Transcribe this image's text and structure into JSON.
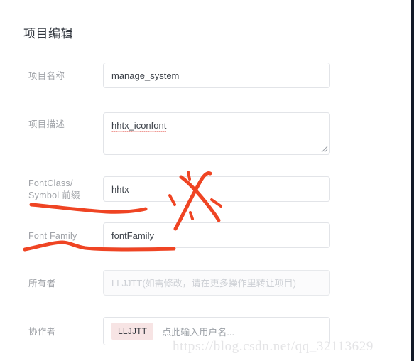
{
  "page": {
    "title": "项目编辑"
  },
  "form": {
    "rows": [
      {
        "label": "项目名称",
        "type": "text",
        "value": "manage_system",
        "name": "project-name"
      },
      {
        "label": "项目描述",
        "type": "textarea",
        "value": "hhtx_iconfont",
        "name": "project-description"
      },
      {
        "label": "FontClass/\nSymbol 前缀",
        "type": "text",
        "value": "hhtx",
        "name": "fontclass-prefix"
      },
      {
        "label": "Font Family",
        "type": "text",
        "value": "fontFamily",
        "name": "font-family"
      },
      {
        "label": "所有者",
        "type": "text-disabled",
        "value": "",
        "placeholder": "LLJJTT(如需修改，请在更多操作里转让项目)",
        "name": "owner"
      },
      {
        "label": "协作者",
        "type": "tags",
        "tags": [
          "LLJJTT"
        ],
        "placeholder": "点此输入用户名...",
        "name": "collaborators"
      }
    ]
  },
  "annotations": {
    "stroke_color": "#ef4423",
    "marks": [
      {
        "name": "scribble-x-mark",
        "shape": "x-cross-with-ticks"
      },
      {
        "name": "underline-fontclass",
        "shape": "wavy-underline"
      },
      {
        "name": "underline-font-family",
        "shape": "wavy-underline"
      }
    ]
  },
  "watermark": {
    "text": "https://blog.csdn.net/qq_32113629"
  }
}
